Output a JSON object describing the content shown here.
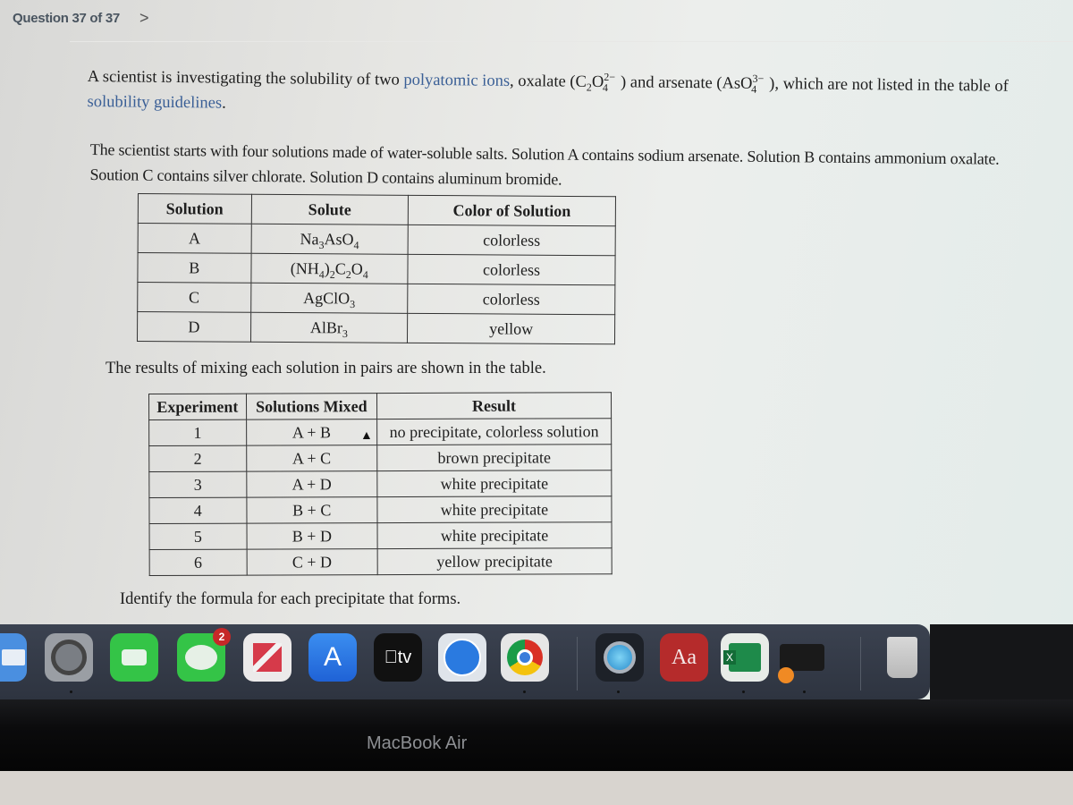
{
  "header": {
    "question_counter": "Question 37 of 37",
    "next_icon": "chevron-right-icon",
    "next_glyph": ">"
  },
  "intro": {
    "part1": "A scientist is investigating the solubility of two ",
    "link1": "polyatomic ions",
    "part2": ", oxalate (C",
    "oxalate_sub1": "2",
    "oxalate_mid": "O",
    "oxalate_sup": "2−",
    "oxalate_sub2": "4",
    "part3": ") and arsenate (AsO",
    "arsenate_sup": "3−",
    "arsenate_sub": "4",
    "part4": "), which are not listed in the table of ",
    "link2": "solubility guidelines",
    "part5": "."
  },
  "setup_text": "The scientist starts with four solutions made of water-soluble salts. Solution A contains sodium arsenate. Solution B contains ammonium oxalate. Soution C contains silver chlorate. Solution D contains aluminum bromide.",
  "solutions_table": {
    "headers": [
      "Solution",
      "Solute",
      "Color of Solution"
    ],
    "rows": [
      {
        "solution": "A",
        "solute_html": "Na<sub>3</sub>AsO<sub>4</sub>",
        "color": "colorless"
      },
      {
        "solution": "B",
        "solute_html": "(NH<sub>4</sub>)<sub>2</sub>C<sub>2</sub>O<sub>4</sub>",
        "color": "colorless"
      },
      {
        "solution": "C",
        "solute_html": "AgClO<sub>3</sub>",
        "color": "colorless"
      },
      {
        "solution": "D",
        "solute_html": "AlBr<sub>3</sub>",
        "color": "yellow"
      }
    ]
  },
  "results_intro": "The results of mixing each solution in pairs are shown in the table.",
  "results_table": {
    "headers": [
      "Experiment",
      "Solutions Mixed",
      "Result"
    ],
    "rows": [
      {
        "experiment": "1",
        "mixed": "A + B",
        "result": "no precipitate, colorless solution"
      },
      {
        "experiment": "2",
        "mixed": "A + C",
        "result": "brown precipitate"
      },
      {
        "experiment": "3",
        "mixed": "A + D",
        "result": "white precipitate"
      },
      {
        "experiment": "4",
        "mixed": "B + C",
        "result": "white precipitate"
      },
      {
        "experiment": "5",
        "mixed": "B + D",
        "result": "white precipitate"
      },
      {
        "experiment": "6",
        "mixed": "C + D",
        "result": "yellow precipitate"
      }
    ]
  },
  "prompt": "Identify the formula for each precipitate that forms.",
  "dock": {
    "apps": [
      {
        "name": "Mail",
        "icon": "mail-icon"
      },
      {
        "name": "System Preferences",
        "icon": "gear-icon"
      },
      {
        "name": "FaceTime",
        "icon": "video-camera-icon"
      },
      {
        "name": "Messages",
        "icon": "message-bubble-icon",
        "badge": "2"
      },
      {
        "name": "News",
        "icon": "news-icon"
      },
      {
        "name": "App Store",
        "icon": "app-store-icon"
      },
      {
        "name": "TV",
        "icon": "apple-tv-icon",
        "label": "tv"
      },
      {
        "name": "Safari",
        "icon": "compass-icon"
      },
      {
        "name": "Chrome",
        "icon": "chrome-icon"
      },
      {
        "name": "QuickTime Player",
        "icon": "quicktime-icon"
      },
      {
        "name": "Dictionary",
        "icon": "dictionary-icon",
        "label": "Aa"
      },
      {
        "name": "Excel",
        "icon": "excel-icon",
        "label": "X"
      },
      {
        "name": "Printer",
        "icon": "printer-icon"
      },
      {
        "name": "Trash",
        "icon": "trash-icon"
      }
    ]
  },
  "device_label": "MacBook Air",
  "colors": {
    "link": "#3a5f96",
    "dock": "#333a46",
    "badge": "#c62828"
  }
}
